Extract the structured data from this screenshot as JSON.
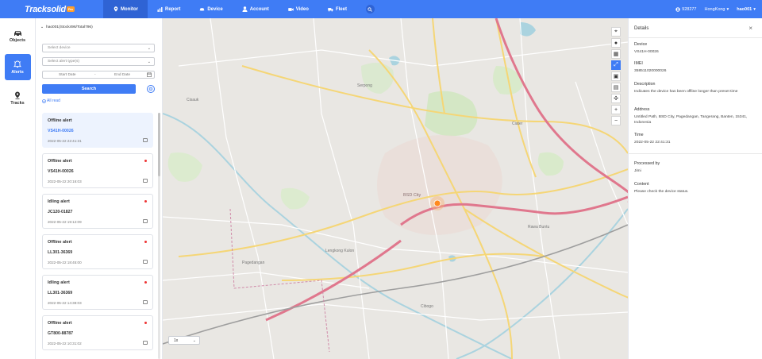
{
  "topbar": {
    "logo_text": "Tracksolid",
    "logo_badge": "Pro",
    "nav": [
      {
        "label": "Monitor",
        "icon": "map-pin-icon",
        "active": true
      },
      {
        "label": "Report",
        "icon": "chart-icon"
      },
      {
        "label": "Device",
        "icon": "car-icon"
      },
      {
        "label": "Account",
        "icon": "user-icon"
      },
      {
        "label": "Video",
        "icon": "video-icon"
      },
      {
        "label": "Fleet",
        "icon": "truck-icon"
      }
    ],
    "account_id": "928277",
    "timezone": "HongKong",
    "username": "hao001"
  },
  "leftnav": [
    {
      "label": "Objects",
      "icon": "car-icon"
    },
    {
      "label": "Alerts",
      "icon": "bell-icon",
      "active": true
    },
    {
      "label": "Tracks",
      "icon": "route-pin-icon"
    }
  ],
  "alert_panel": {
    "tree_label": "hao001(Stock496/Total796)",
    "device_placeholder": "Select device",
    "alert_type_placeholder": "Select alert type(s)",
    "start_date": "Start Date",
    "date_separator": "-",
    "end_date": "End Date",
    "search_label": "Search",
    "all_read_label": "All read",
    "alerts": [
      {
        "type": "Offline alert",
        "device": "VS41H-00026",
        "time": "2022-05-22 22:41:31",
        "selected": true,
        "unread": false
      },
      {
        "type": "Offline alert",
        "device": "VS41H-00026",
        "time": "2022-05-22 20:16:03",
        "selected": false,
        "unread": true
      },
      {
        "type": "Idling alert",
        "device": "JC120-01827",
        "time": "2022-05-22 19:12:09",
        "selected": false,
        "unread": true
      },
      {
        "type": "Offline alert",
        "device": "LL301-36369",
        "time": "2022-05-22 18:45:00",
        "selected": false,
        "unread": true
      },
      {
        "type": "Idling alert",
        "device": "LL301-36369",
        "time": "2022-05-22 14:38:03",
        "selected": false,
        "unread": true
      },
      {
        "type": "Offline alert",
        "device": "GT800-88787",
        "time": "2022-05-22 10:31:02",
        "selected": false,
        "unread": true
      }
    ]
  },
  "map": {
    "playback_speed": "1x",
    "labels": [
      {
        "text": "BSD City"
      },
      {
        "text": "Serpong"
      },
      {
        "text": "Pagedangan"
      },
      {
        "text": "Ciater"
      },
      {
        "text": "Cisauk"
      },
      {
        "text": "Rawa Buntu"
      },
      {
        "text": "Lengkong Kulon"
      },
      {
        "text": "Cibogo"
      }
    ]
  },
  "details": {
    "title": "Details",
    "device_label": "Device",
    "device_value": "VS41H-00026",
    "imei_label": "IMEI",
    "imei_value": "358511020000026",
    "description_label": "Description",
    "description_value": "Indicates the device has been offline longer than preset time",
    "address_label": "Address",
    "address_value": "Untitled Path, BSD City, Pagedangan, Tangerang, Banten, 15341, Indonesia",
    "time_label": "Time",
    "time_value": "2022-05-22 22:41:31",
    "processed_by_label": "Processed by",
    "processed_by_value": "Jimi",
    "content_label": "Content",
    "content_value": "Please check the device status."
  },
  "colors": {
    "primary": "#3f7cf5",
    "unread_dot": "#e33333",
    "highway": "#e0778d",
    "road": "#f5d676"
  }
}
